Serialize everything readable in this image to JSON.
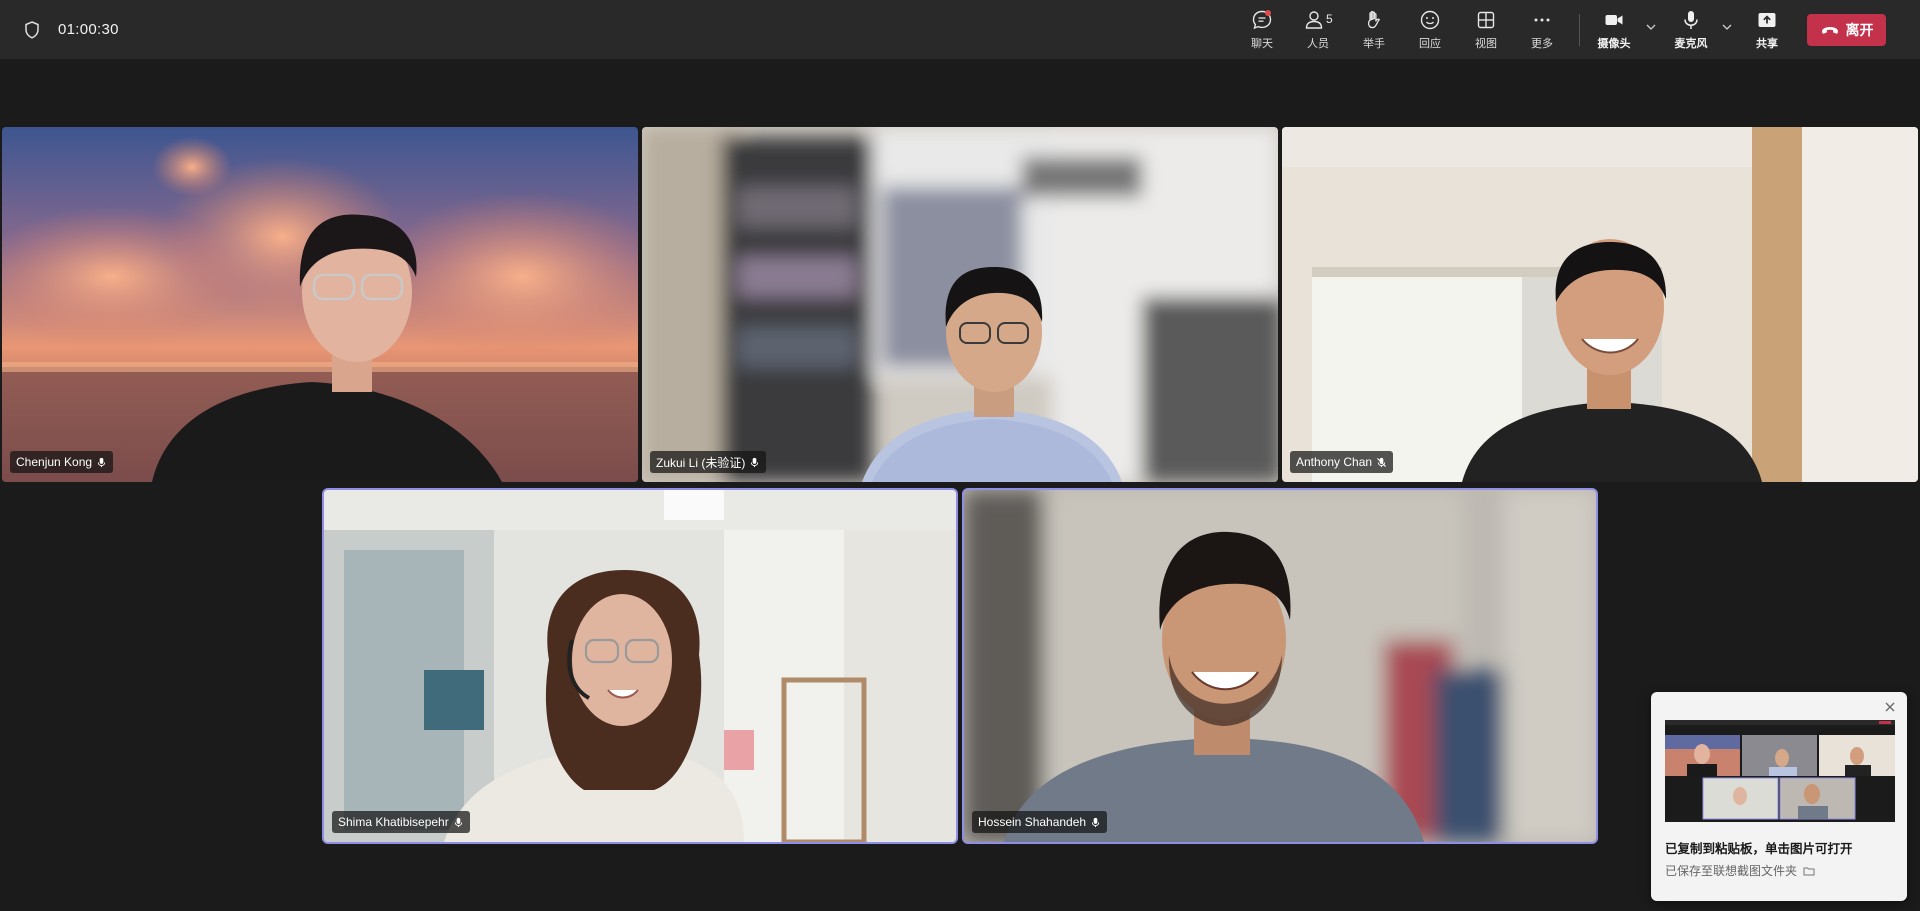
{
  "meeting": {
    "timer": "01:00:30"
  },
  "toolbar": {
    "chat": {
      "label": "聊天",
      "icon": "chat-icon"
    },
    "people": {
      "label": "人员",
      "count": "5",
      "icon": "people-icon"
    },
    "raise_hand": {
      "label": "举手",
      "icon": "hand-icon"
    },
    "react": {
      "label": "回应",
      "icon": "smiley-icon"
    },
    "view": {
      "label": "视图",
      "icon": "grid-icon"
    },
    "more": {
      "label": "更多",
      "icon": "ellipsis-icon"
    },
    "camera": {
      "label": "摄像头",
      "icon": "camera-icon"
    },
    "mic": {
      "label": "麦克风",
      "icon": "microphone-icon"
    },
    "share": {
      "label": "共享",
      "icon": "share-icon"
    },
    "leave": {
      "label": "离开",
      "icon": "phone-hangup-icon",
      "color": "#c4314b"
    }
  },
  "participants": [
    {
      "name": "Chenjun Kong"
    },
    {
      "name": "Zukui Li (未验证)"
    },
    {
      "name": "Anthony Chan"
    },
    {
      "name": "Shima Khatibisepehr"
    },
    {
      "name": "Hossein Shahandeh"
    }
  ],
  "toast": {
    "title": "已复制到粘贴板，单击图片可打开",
    "subtitle": "已保存至联想截图文件夹"
  },
  "colors": {
    "active_speaker_outline": "#8f8fe6",
    "background": "#1b1b1b",
    "toolbar": "#292929"
  }
}
